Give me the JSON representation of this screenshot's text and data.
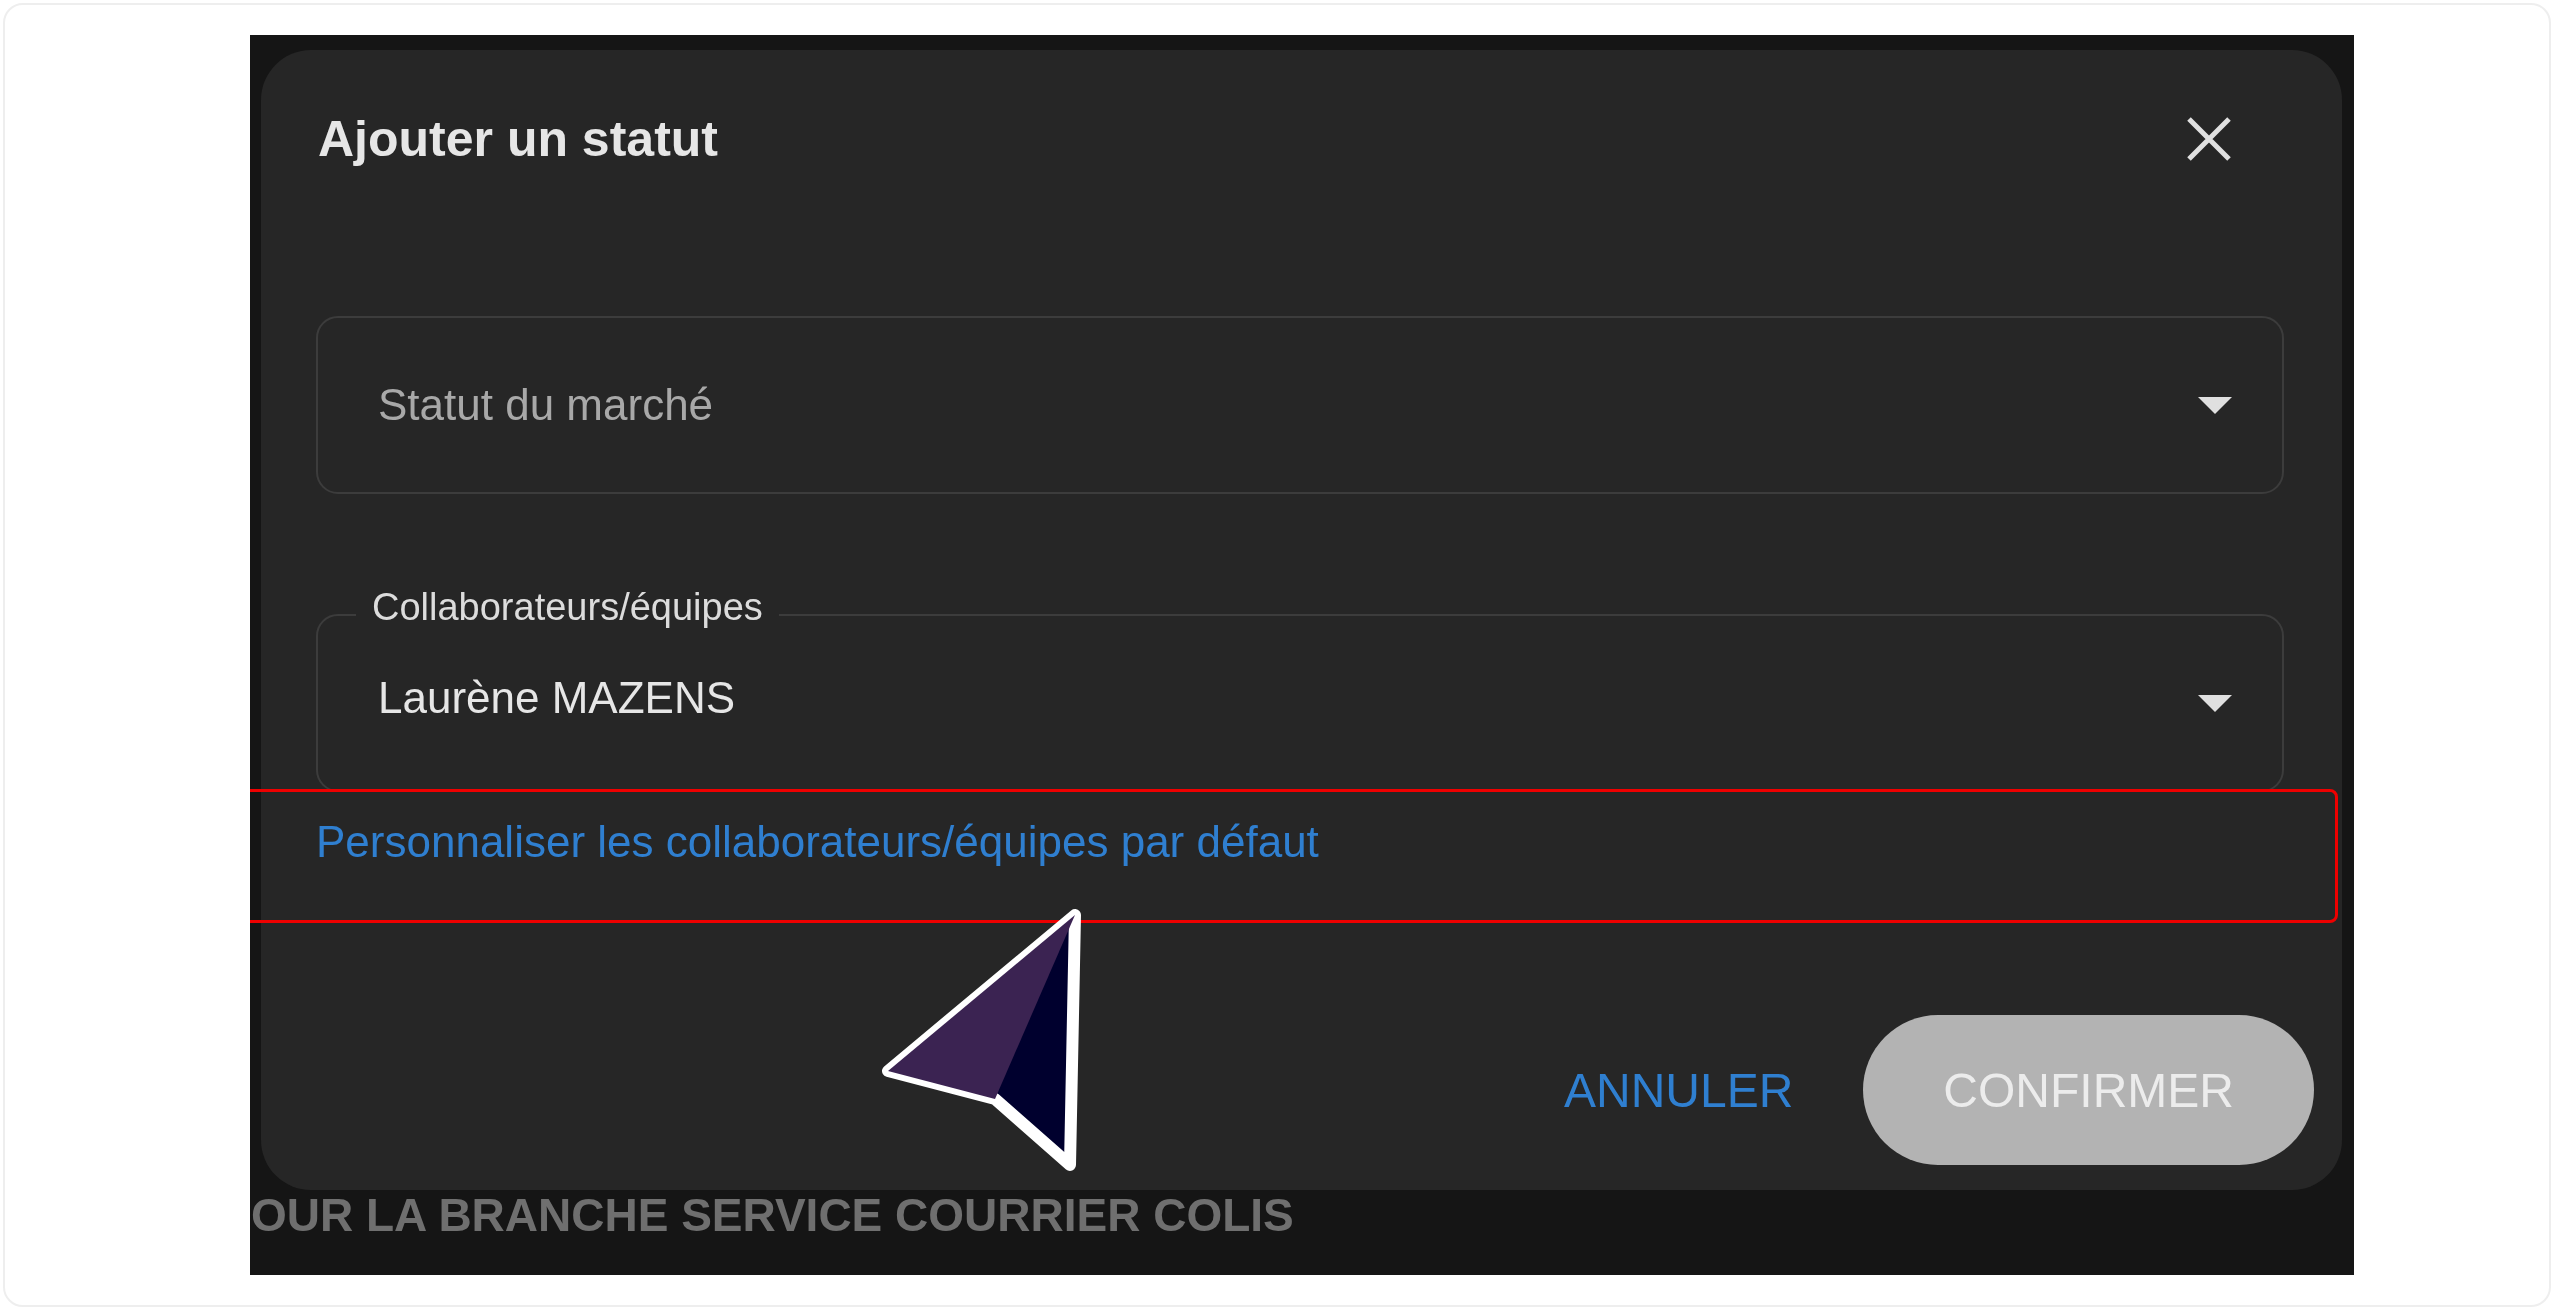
{
  "dialog": {
    "title": "Ajouter un statut",
    "fields": [
      {
        "kind": "select",
        "placeholder": "Statut du marché"
      },
      {
        "kind": "select",
        "label": "Collaborateurs/équipes",
        "value": "Laurène MAZENS"
      }
    ],
    "link": {
      "text": "Personnaliser les collaborateurs/équipes par défaut",
      "highlighted": true
    },
    "buttons": [
      {
        "kind": "text",
        "label": "ANNULER",
        "disabled": false
      },
      {
        "kind": "filled",
        "label": "CONFIRMER",
        "disabled": true
      }
    ]
  },
  "background_text": "OUR LA BRANCHE SERVICE COURRIER COLIS"
}
